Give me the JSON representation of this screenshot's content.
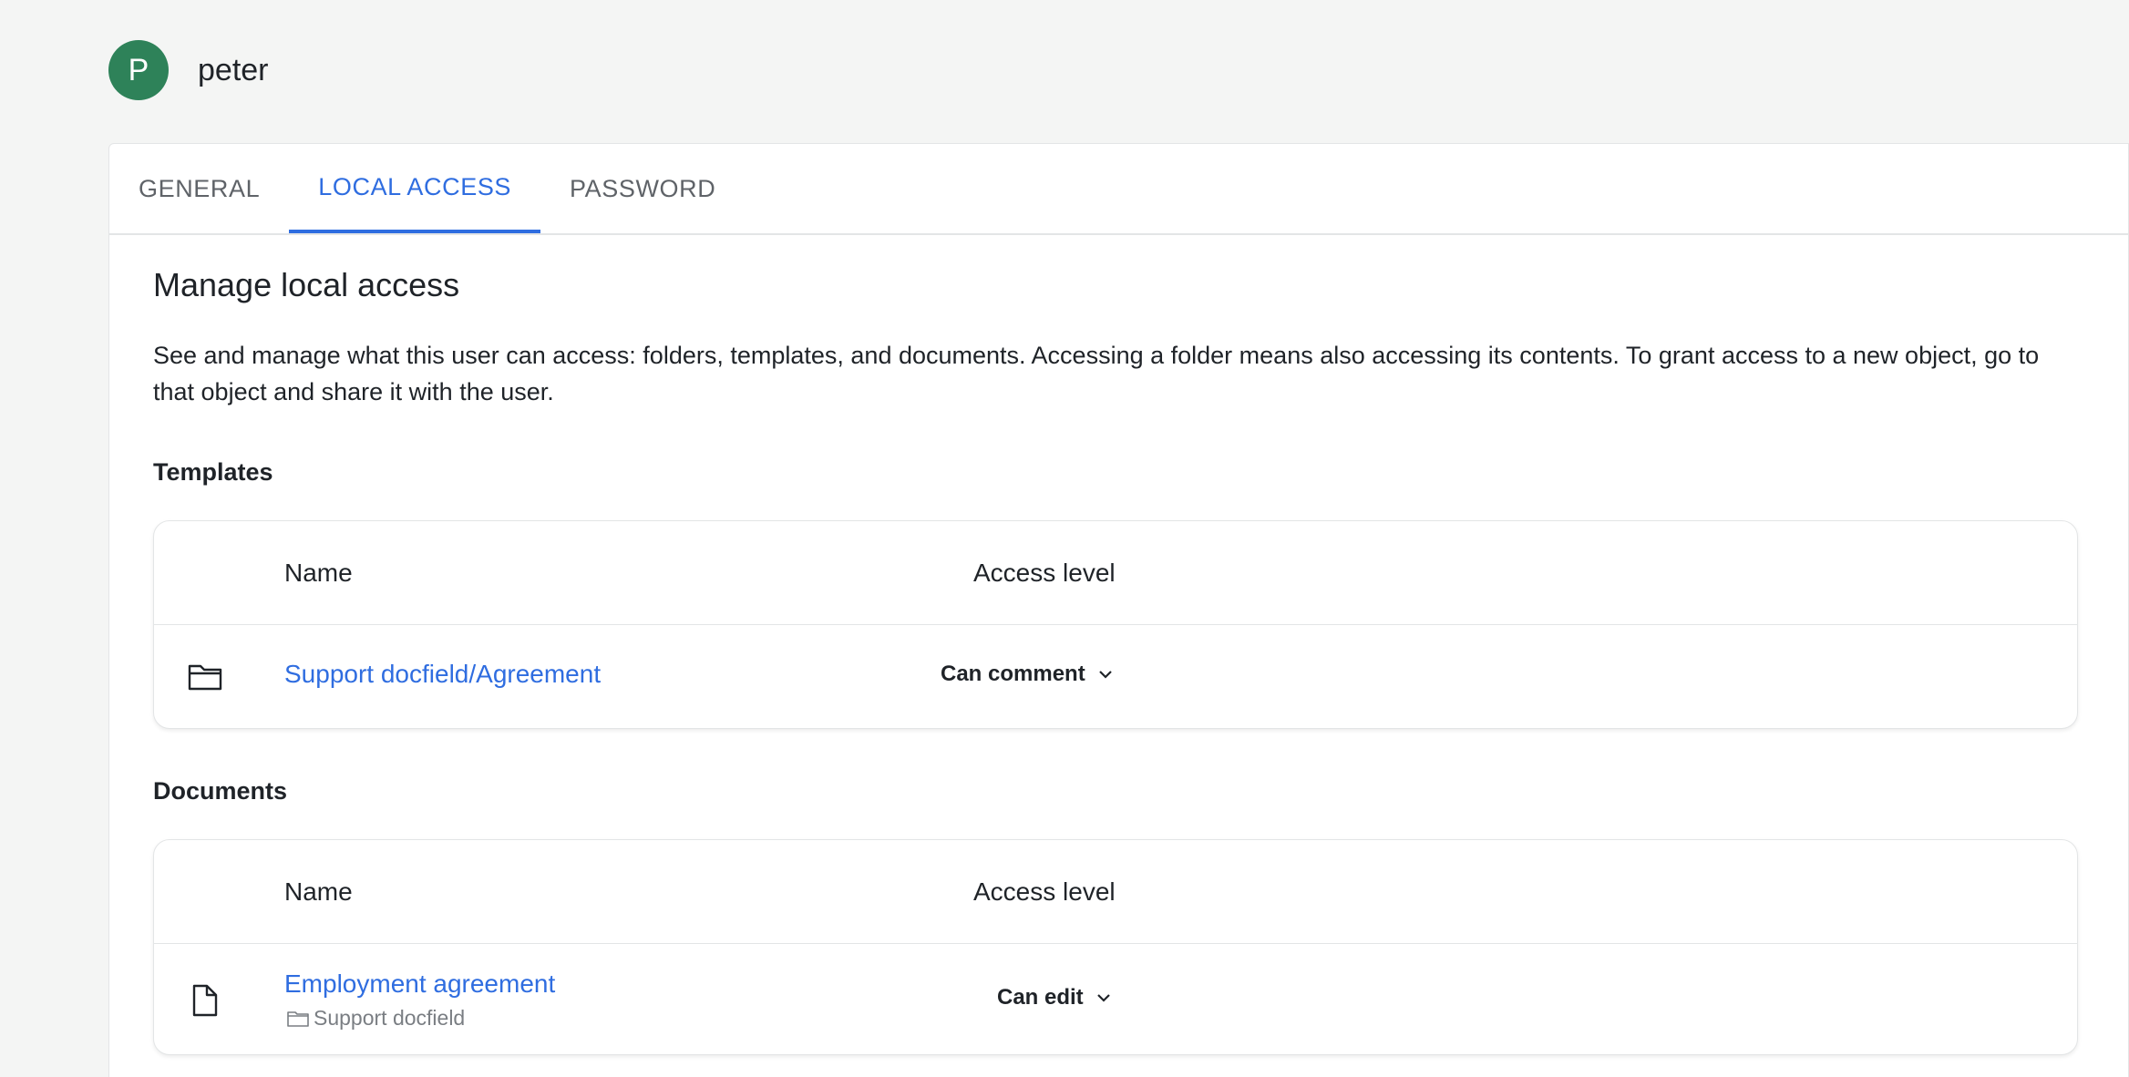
{
  "user": {
    "avatar_initial": "P",
    "name": "peter"
  },
  "tabs": [
    {
      "label": "GENERAL",
      "active": false
    },
    {
      "label": "LOCAL ACCESS",
      "active": true
    },
    {
      "label": "PASSWORD",
      "active": false
    }
  ],
  "section": {
    "title": "Manage local access",
    "description": "See and manage what this user can access: folders, templates, and documents. Accessing a folder means also accessing its contents. To grant access to a new object, go to that object and share it with the user."
  },
  "templates": {
    "heading": "Templates",
    "columns": {
      "name": "Name",
      "access": "Access level"
    },
    "rows": [
      {
        "icon": "folder-icon",
        "name": "Support docfield/Agreement",
        "access": "Can comment"
      }
    ]
  },
  "documents": {
    "heading": "Documents",
    "columns": {
      "name": "Name",
      "access": "Access level"
    },
    "rows": [
      {
        "icon": "document-icon",
        "name": "Employment agreement",
        "location": "Support docfield",
        "access": "Can edit"
      }
    ]
  },
  "colors": {
    "accent": "#2f6de0",
    "avatar": "#2e8259"
  }
}
